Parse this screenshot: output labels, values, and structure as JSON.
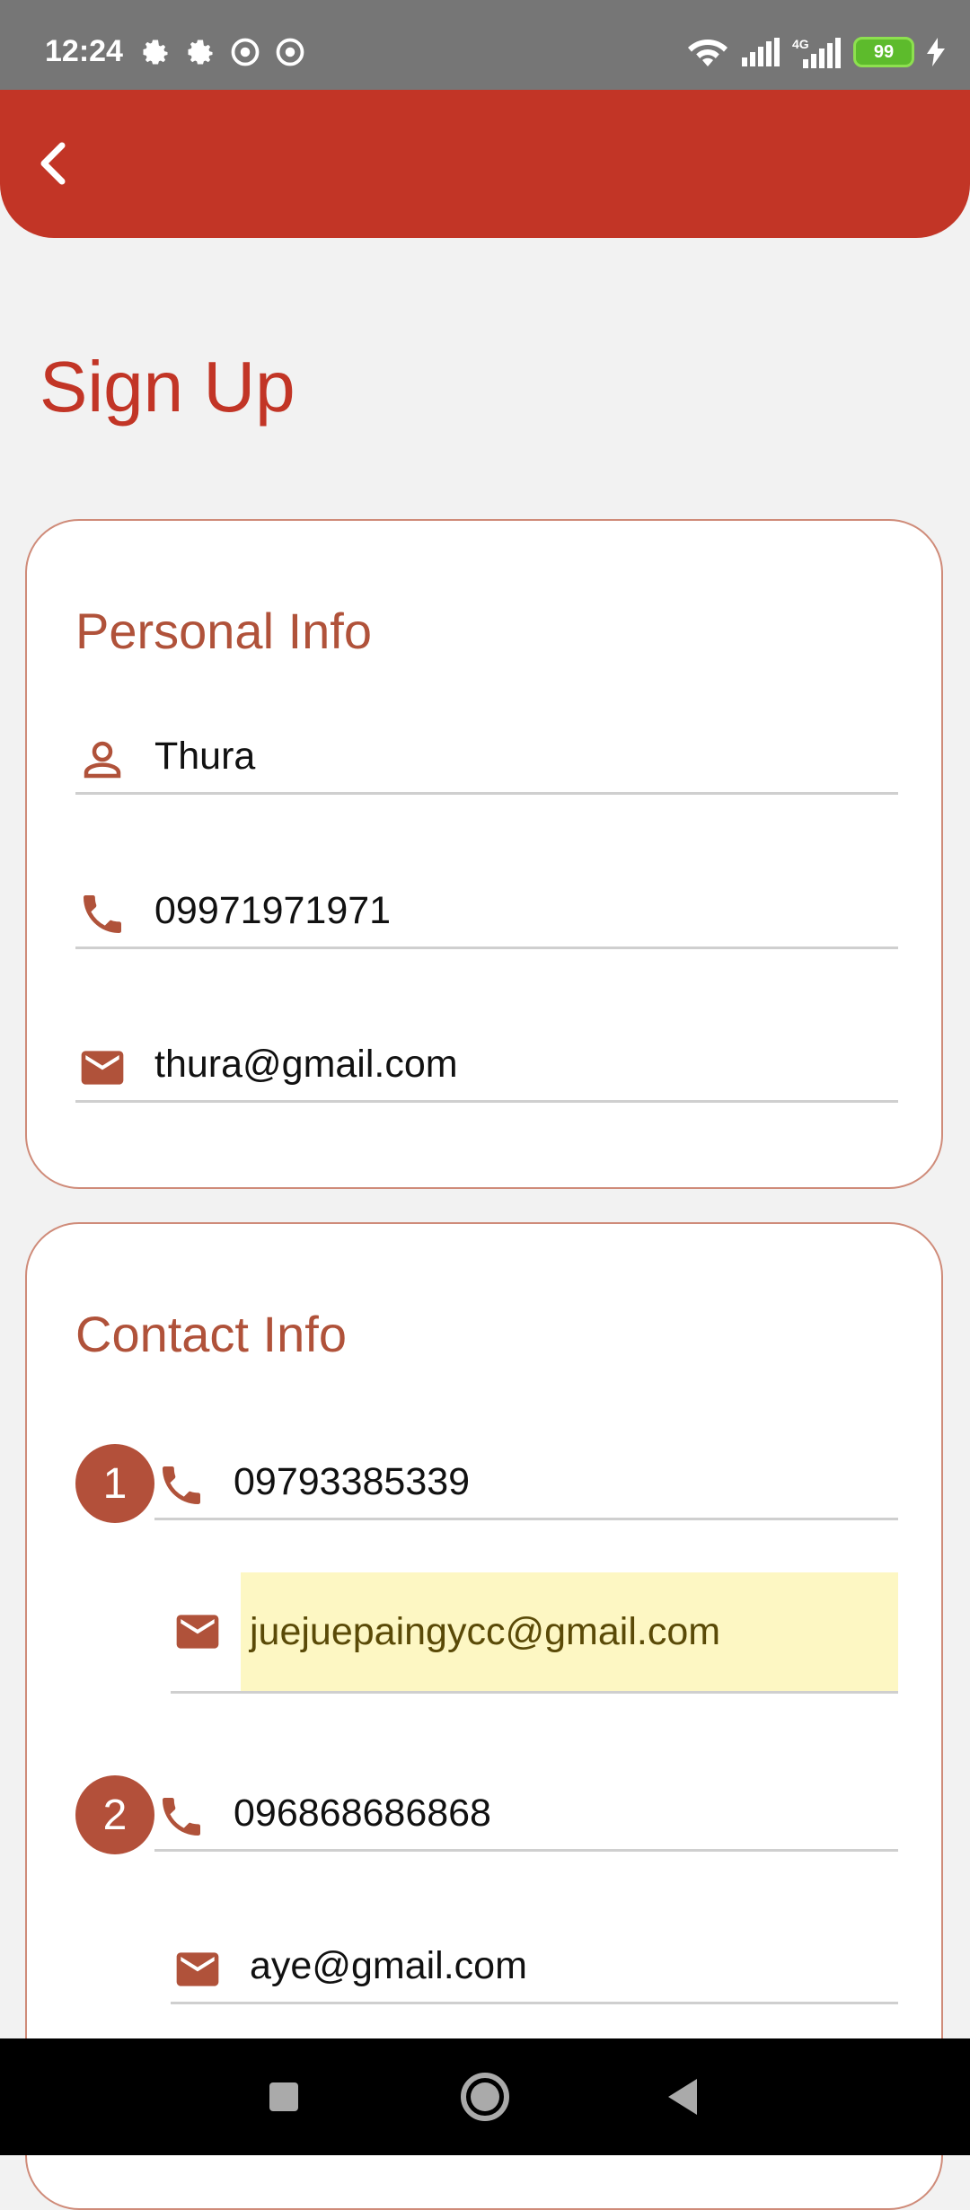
{
  "status_bar": {
    "time": "12:24",
    "battery": "99"
  },
  "page": {
    "title": "Sign Up"
  },
  "personal_info": {
    "title": "Personal Info",
    "name": "Thura",
    "phone": "09971971971",
    "email": "thura@gmail.com"
  },
  "contact_info": {
    "title": "Contact Info",
    "contacts": [
      {
        "number": "1",
        "phone": "09793385339",
        "email": "juejuepaingycc@gmail.com"
      },
      {
        "number": "2",
        "phone": "096868686868",
        "email": "aye@gmail.com"
      }
    ]
  },
  "colors": {
    "app_bar": "#c23526",
    "accent": "#b0523a",
    "highlight": "#fdf7c3"
  },
  "icons": [
    "settings-icon",
    "person-icon",
    "phone-icon",
    "mail-icon",
    "back-icon"
  ]
}
